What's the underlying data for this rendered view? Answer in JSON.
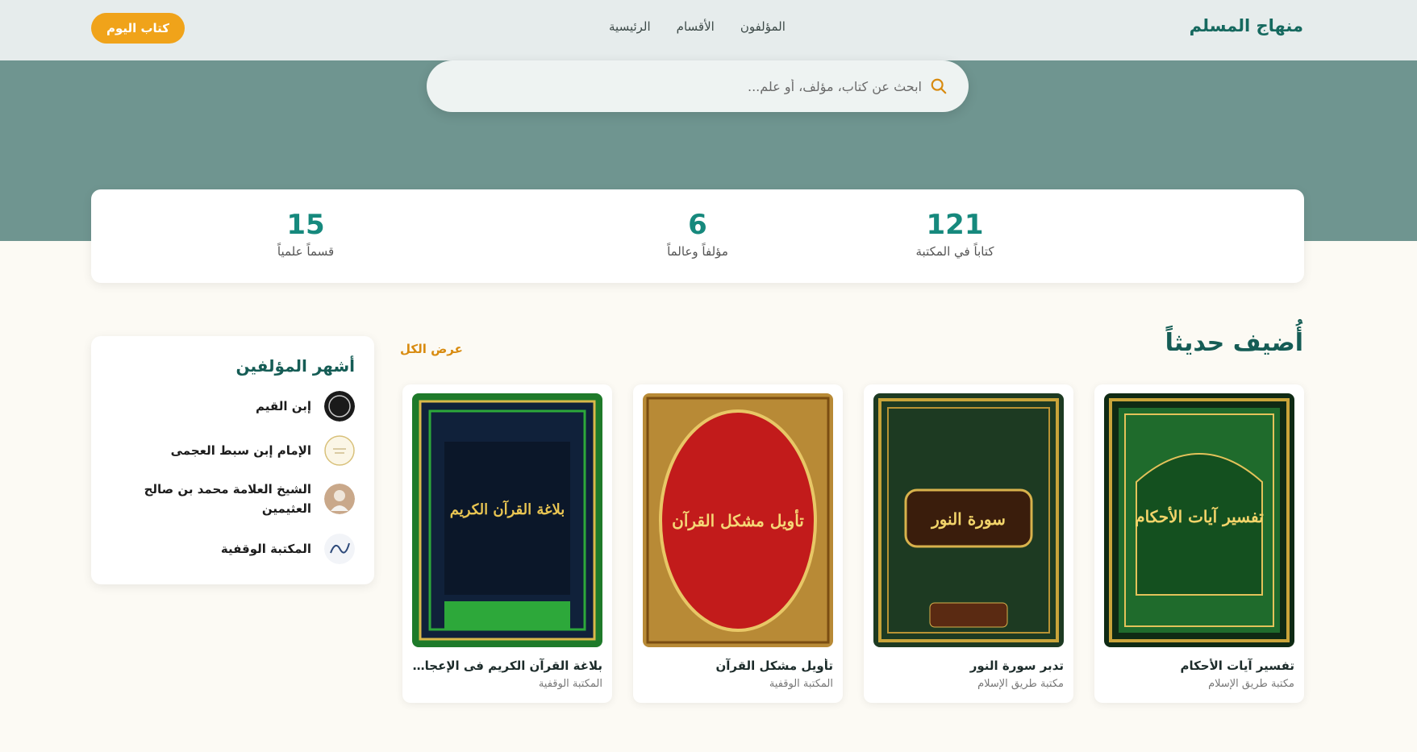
{
  "header": {
    "brand": "منهاج المسلم",
    "nav": [
      "الرئيسية",
      "الأقسام",
      "المؤلفون"
    ],
    "cta": "كتاب اليوم"
  },
  "search": {
    "placeholder": "ابحث عن كتاب، مؤلف، أو علم..."
  },
  "stats": [
    {
      "value": "121",
      "label": "كتاباً في المكتبة"
    },
    {
      "value": "6",
      "label": "مؤلفاً وعالماً"
    },
    {
      "value": "15",
      "label": "قسماً علمياً"
    }
  ],
  "recent": {
    "title": "أُضيف حديثاً",
    "view_all": "عرض الكل",
    "books": [
      {
        "title": "تفسير آيات الأحكام",
        "publisher": "مكتبة طريق الإسلام",
        "cover_title": "تفسير آيات الأحكام",
        "cover_color": "#1f6b2c"
      },
      {
        "title": "تدبر سورة النور",
        "publisher": "مكتبة طريق الإسلام",
        "cover_title": "سورة النور",
        "cover_color": "#1d3a22"
      },
      {
        "title": "تأويل مشكل القرآن",
        "publisher": "المكتبة الوقفية",
        "cover_title": "تأويل مشكل القرآن",
        "cover_color": "#c21b1b"
      },
      {
        "title": "بلاغة القرآن الكريم فى الإعجاز إعرابا وتفسيرا بإيجاز",
        "publisher": "المكتبة الوقفية",
        "cover_title": "بلاغة القرآن الكريم",
        "cover_color": "#10213a"
      }
    ]
  },
  "authors": {
    "title": "أشهر المؤلفين",
    "items": [
      {
        "name": "إبن القيم"
      },
      {
        "name": "الإمام إبن سبط العجمى"
      },
      {
        "name": "الشيخ العلامة محمد بن صالح العثيمين"
      },
      {
        "name": "المكتبة الوقفية"
      }
    ]
  },
  "colors": {
    "primary": "#16695f",
    "accent": "#f0a31a",
    "hero": "#6f9590"
  }
}
